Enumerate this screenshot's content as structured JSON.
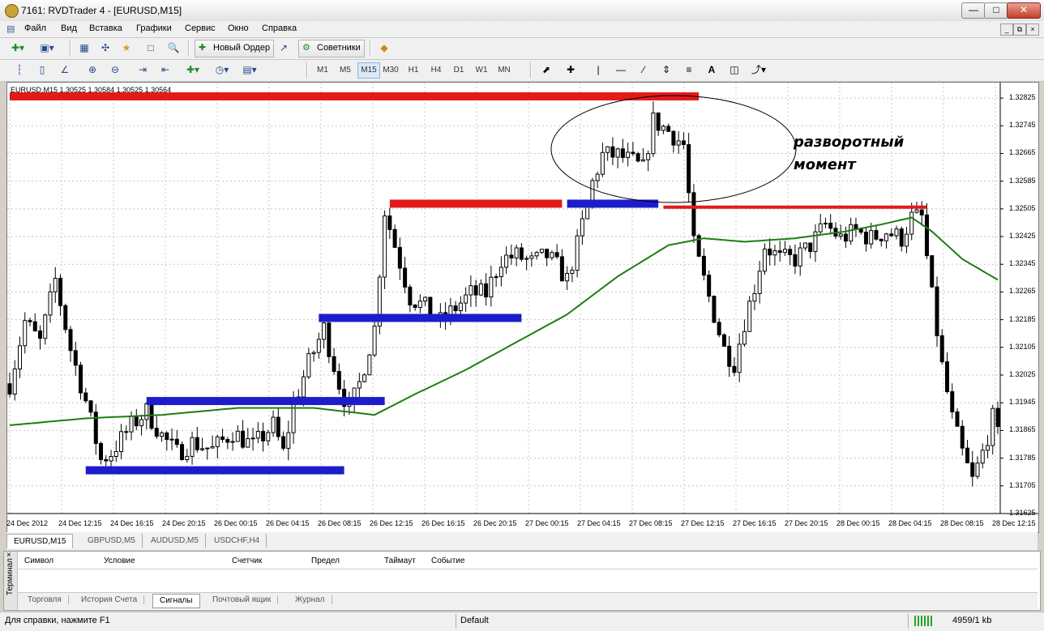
{
  "window": {
    "title": "7161: RVDTrader 4 - [EURUSD,M15]"
  },
  "menu": [
    "Файл",
    "Вид",
    "Вставка",
    "Графики",
    "Сервис",
    "Окно",
    "Справка"
  ],
  "toolbar": {
    "new_order_label": "Новый Ордер",
    "experts_label": "Советники",
    "timeframes": [
      "M1",
      "M5",
      "M15",
      "M30",
      "H1",
      "H4",
      "D1",
      "W1",
      "MN"
    ],
    "active_timeframe": "M15",
    "badge": "4"
  },
  "chart": {
    "info": "EURUSD,M15  1.30525 1.30584 1.30525 1.30564",
    "annotation_line1": "разворотный",
    "annotation_line2": "момент"
  },
  "chart_data": {
    "type": "candlestick",
    "symbol": "EURUSD",
    "timeframe": "M15",
    "ohlc_last": {
      "open": 1.30525,
      "high": 1.30584,
      "low": 1.30525,
      "close": 1.30564
    },
    "ylim": [
      1.31625,
      1.32865
    ],
    "y_ticks": [
      "1.32825",
      "1.32745",
      "1.32665",
      "1.32585",
      "1.32505",
      "1.32425",
      "1.32345",
      "1.32265",
      "1.32185",
      "1.32105",
      "1.32025",
      "1.31945",
      "1.31865",
      "1.31785",
      "1.31705",
      "1.31625"
    ],
    "x_ticks": [
      "24 Dec 2012",
      "24 Dec 12:15",
      "24 Dec 16:15",
      "24 Dec 20:15",
      "26 Dec 00:15",
      "26 Dec 04:15",
      "26 Dec 08:15",
      "26 Dec 12:15",
      "26 Dec 16:15",
      "26 Dec 20:15",
      "27 Dec 00:15",
      "27 Dec 04:15",
      "27 Dec 08:15",
      "27 Dec 12:15",
      "27 Dec 16:15",
      "27 Dec 20:15",
      "28 Dec 00:15",
      "28 Dec 04:15",
      "28 Dec 08:15",
      "28 Dec 12:15"
    ],
    "price_path": [
      [
        0,
        1.32
      ],
      [
        3,
        1.3218
      ],
      [
        6,
        1.3212
      ],
      [
        9,
        1.323
      ],
      [
        12,
        1.321
      ],
      [
        15,
        1.3195
      ],
      [
        18,
        1.3178
      ],
      [
        20,
        1.318
      ],
      [
        24,
        1.3188
      ],
      [
        27,
        1.3192
      ],
      [
        30,
        1.3185
      ],
      [
        33,
        1.318
      ],
      [
        36,
        1.3183
      ],
      [
        40,
        1.3181
      ],
      [
        44,
        1.3186
      ],
      [
        48,
        1.3182
      ],
      [
        52,
        1.3188
      ],
      [
        54,
        1.318
      ],
      [
        56,
        1.3194
      ],
      [
        59,
        1.3206
      ],
      [
        62,
        1.3216
      ],
      [
        65,
        1.32
      ],
      [
        67,
        1.3192
      ],
      [
        69,
        1.32
      ],
      [
        72,
        1.3216
      ],
      [
        74,
        1.325
      ],
      [
        76,
        1.324
      ],
      [
        79,
        1.3225
      ],
      [
        82,
        1.3222
      ],
      [
        85,
        1.3218
      ],
      [
        88,
        1.3222
      ],
      [
        91,
        1.3226
      ],
      [
        94,
        1.3226
      ],
      [
        97,
        1.3236
      ],
      [
        100,
        1.3237
      ],
      [
        103,
        1.3235
      ],
      [
        106,
        1.3237
      ],
      [
        108,
        1.3234
      ],
      [
        110,
        1.323
      ],
      [
        112,
        1.324
      ],
      [
        115,
        1.3258
      ],
      [
        117,
        1.3266
      ],
      [
        120,
        1.3266
      ],
      [
        123,
        1.3264
      ],
      [
        125,
        1.3262
      ],
      [
        127,
        1.3276
      ],
      [
        130,
        1.3273
      ],
      [
        133,
        1.3269
      ],
      [
        135,
        1.324
      ],
      [
        137,
        1.323
      ],
      [
        139,
        1.322
      ],
      [
        141,
        1.321
      ],
      [
        143,
        1.3206
      ],
      [
        145,
        1.3218
      ],
      [
        147,
        1.3228
      ],
      [
        149,
        1.324
      ],
      [
        152,
        1.3236
      ],
      [
        155,
        1.3236
      ],
      [
        158,
        1.324
      ],
      [
        161,
        1.3246
      ],
      [
        164,
        1.3242
      ],
      [
        167,
        1.3244
      ],
      [
        170,
        1.3242
      ],
      [
        173,
        1.3244
      ],
      [
        176,
        1.3242
      ],
      [
        178,
        1.3248
      ],
      [
        180,
        1.3248
      ],
      [
        182,
        1.3225
      ],
      [
        184,
        1.3205
      ],
      [
        186,
        1.319
      ],
      [
        188,
        1.318
      ],
      [
        190,
        1.3172
      ],
      [
        192,
        1.318
      ],
      [
        194,
        1.319
      ],
      [
        195,
        1.3185
      ]
    ],
    "ma_path": [
      [
        0,
        1.3188
      ],
      [
        15,
        1.319
      ],
      [
        30,
        1.3191
      ],
      [
        45,
        1.3193
      ],
      [
        60,
        1.3193
      ],
      [
        72,
        1.3191
      ],
      [
        80,
        1.3197
      ],
      [
        90,
        1.3204
      ],
      [
        100,
        1.3212
      ],
      [
        110,
        1.322
      ],
      [
        120,
        1.3231
      ],
      [
        130,
        1.324
      ],
      [
        137,
        1.3242
      ],
      [
        145,
        1.3241
      ],
      [
        155,
        1.3242
      ],
      [
        165,
        1.3244
      ],
      [
        172,
        1.3246
      ],
      [
        178,
        1.3248
      ],
      [
        182,
        1.3244
      ],
      [
        188,
        1.3236
      ],
      [
        195,
        1.323
      ]
    ],
    "zones": [
      {
        "color": "red",
        "price": 1.3283,
        "from": 0,
        "to": 136
      },
      {
        "color": "red",
        "price": 1.3252,
        "from": 75,
        "to": 109
      },
      {
        "color": "blue",
        "price": 1.3252,
        "from": 110,
        "to": 128
      },
      {
        "color": "red",
        "price": 1.3251,
        "from": 129,
        "to": 181
      },
      {
        "color": "blue",
        "price": 1.3219,
        "from": 61,
        "to": 101
      },
      {
        "color": "blue",
        "price": 1.3195,
        "from": 27,
        "to": 74
      },
      {
        "color": "blue",
        "price": 1.3175,
        "from": 15,
        "to": 66
      }
    ],
    "colors": {
      "bull": "#000000",
      "bear": "#000000",
      "ma": "#1e7d12",
      "support": "#1c1ccc",
      "resistance": "#e21a1a"
    }
  },
  "chart_tabs": [
    "EURUSD,M15",
    "GBPUSD,M5",
    "AUDUSD,M5",
    "USDCHF,H4"
  ],
  "terminal": {
    "side_label": "Терминал",
    "columns": [
      "Символ",
      "Условие",
      "Счетчик",
      "Предел",
      "Таймаут",
      "Событие"
    ],
    "tabs": [
      "Торговля",
      "История Счета",
      "Сигналы",
      "Почтовый ящик",
      "Журнал"
    ],
    "active_tab": "Сигналы"
  },
  "status": {
    "help": "Для справки, нажмите F1",
    "profile": "Default",
    "connection": "4959/1 kb"
  }
}
